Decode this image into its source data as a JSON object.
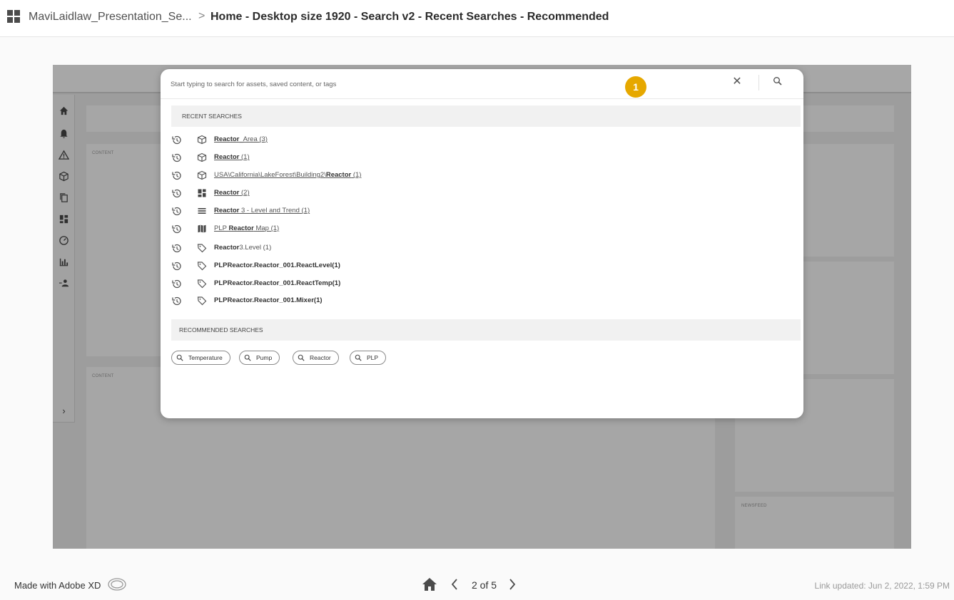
{
  "breadcrumb": {
    "project": "MaviLaidlaw_Presentation_Se...",
    "separator": ">",
    "page": "Home - Desktop size 1920 - Search v2 - Recent Searches - Recommended"
  },
  "artboard": {
    "content_label_1": "CONTENT",
    "content_label_2": "CONTENT",
    "newsfeed_label": "NEWSFEED",
    "sidebar_icons": [
      "home-icon",
      "bell-icon",
      "warning-icon",
      "cube-icon",
      "copy-icon",
      "dashboard-icon",
      "gauge-icon",
      "bar-chart-icon",
      "user-add-icon"
    ],
    "sidebar_expand": "›"
  },
  "search": {
    "placeholder": "Start typing to search for assets, saved content, or tags",
    "close_label": "✕",
    "recent_header": "RECENT SEARCHES",
    "recommended_header": "RECOMMENDED SEARCHES",
    "recent": [
      {
        "icon": "cube-icon",
        "bold": "Reactor",
        "rest": "_Area (3)",
        "prefix": "",
        "underline": true
      },
      {
        "icon": "cube-icon",
        "bold": "Reactor",
        "rest": " (1)",
        "prefix": "",
        "underline": true
      },
      {
        "icon": "cube-icon",
        "bold": "Reactor",
        "rest": " (1)",
        "prefix": "USA\\California\\LakeForest\\Building2\\",
        "underline": true
      },
      {
        "icon": "dashboard-icon",
        "bold": "Reactor",
        "rest": " (2)",
        "prefix": "",
        "underline": true
      },
      {
        "icon": "list-icon",
        "bold": "Reactor",
        "rest": " 3 - Level and Trend (1)",
        "prefix": "",
        "underline": true
      },
      {
        "icon": "map-icon",
        "bold": "Reactor",
        "rest": " Map (1)",
        "prefix": "PLP ",
        "underline": true
      },
      {
        "icon": "tag-icon",
        "bold": "Reactor",
        "rest": "3.Level (1)",
        "prefix": "",
        "underline": false
      },
      {
        "icon": "tag-icon",
        "bold": "PLPReactor.Reactor_001.ReactLevel(1)",
        "rest": "",
        "prefix": "",
        "underline": false
      },
      {
        "icon": "tag-icon",
        "bold": "PLPReactor.Reactor_001.ReactTemp(1)",
        "rest": "",
        "prefix": "",
        "underline": false
      },
      {
        "icon": "tag-icon",
        "bold": "PLPReactor.Reactor_001.Mixer(1)",
        "rest": "",
        "prefix": "",
        "underline": false
      }
    ],
    "recommended": [
      "Temperature",
      "Pump",
      "Reactor",
      "PLP"
    ]
  },
  "annotation_badge": "1",
  "footer": {
    "made_with": "Made with Adobe XD",
    "page_indicator": "2 of 5",
    "link_updated": "Link updated: Jun 2, 2022, 1:59 PM"
  }
}
